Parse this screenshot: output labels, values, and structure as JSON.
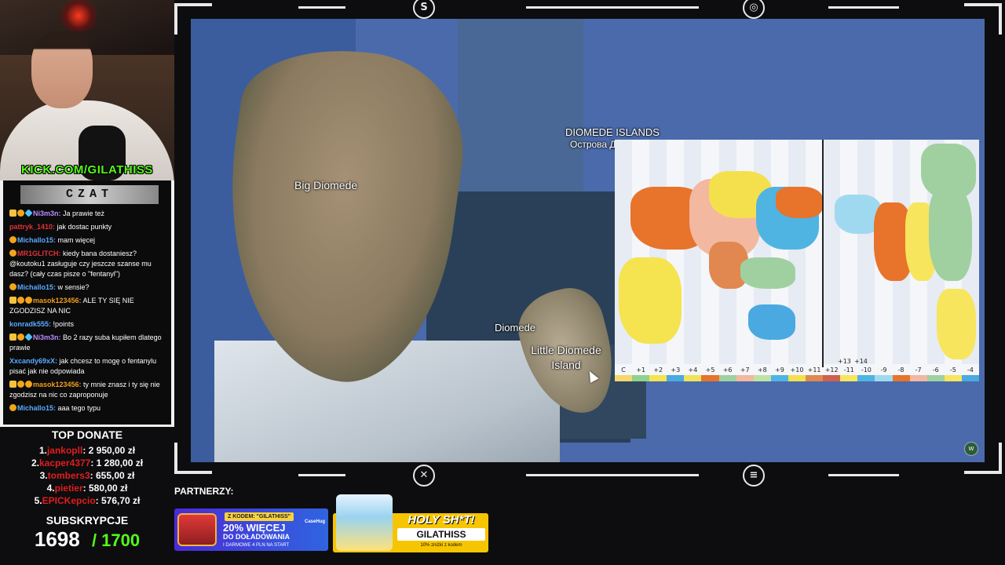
{
  "stream": {
    "kick_url": "KICK.COM/GILATHISS",
    "chat_title": "CZAT"
  },
  "chat": [
    {
      "badges": [
        "crown",
        "coin",
        "gem"
      ],
      "user": "Ni3m3n:",
      "user_color": "#b98cff",
      "text": "Ja prawie też"
    },
    {
      "badges": [],
      "user": "pattryk_1410:",
      "user_color": "#e0323a",
      "text": "jak dostac punkty"
    },
    {
      "badges": [
        "coin"
      ],
      "user": "Michallo15:",
      "user_color": "#5aa9ff",
      "text": "mam więcej"
    },
    {
      "badges": [
        "coin"
      ],
      "user": "MR1GLITCH:",
      "user_color": "#e0323a",
      "text": "kiedy bana dostaniesz? @koutoku1 zasługuje czy jeszcze szanse mu dasz? (cały czas pisze o \"fentanyl\")"
    },
    {
      "badges": [
        "coin"
      ],
      "user": "Michallo15:",
      "user_color": "#5aa9ff",
      "text": "w sensie?"
    },
    {
      "badges": [
        "crown",
        "coin",
        "coin"
      ],
      "user": "masok123456:",
      "user_color": "#f29b1f",
      "text": "ALE TY SIĘ NIE ZGODZISZ NA NIC"
    },
    {
      "badges": [],
      "user": "konradk555:",
      "user_color": "#5aa9ff",
      "text": "!points"
    },
    {
      "badges": [
        "crown",
        "coin",
        "gem"
      ],
      "user": "Ni3m3n:",
      "user_color": "#b98cff",
      "text": "Bo 2 razy suba kupiłem dlatego prawie"
    },
    {
      "badges": [],
      "user": "Xxcandy69xX:",
      "user_color": "#5aa9ff",
      "text": "jak chcesz to mogę o fentanylu pisać jak nie odpowiada"
    },
    {
      "badges": [
        "crown",
        "coin",
        "coin"
      ],
      "user": "masok123456:",
      "user_color": "#f29b1f",
      "text": "ty mnie znasz i ty się nie zgodzisz na nic co zaproponuje"
    },
    {
      "badges": [
        "coin"
      ],
      "user": "Michallo15:",
      "user_color": "#5aa9ff",
      "text": "aaa tego typu"
    }
  ],
  "donate": {
    "title": "TOP DONATE",
    "rows": [
      {
        "rank": "1.",
        "name": "jankopll",
        "amount": ": 2 950,00 zł"
      },
      {
        "rank": "2.",
        "name": "kacper4377",
        "amount": ": 1 280,00 zł"
      },
      {
        "rank": "3.",
        "name": "tombers3",
        "amount": ": 655,00 zł"
      },
      {
        "rank": "4.",
        "name": "pietier",
        "amount": ": 580,00 zł"
      },
      {
        "rank": "5.",
        "name": "EPICKepcio",
        "amount": ": 576,70 zł"
      }
    ]
  },
  "subs": {
    "title": "SUBSKRYPCJE",
    "current": "1698",
    "goal": "/ 1700"
  },
  "map": {
    "region_title": "DIOMEDE ISLANDS",
    "region_subtitle": "Острова Д",
    "big_island": "Big Diomede",
    "diomede": "Diomede",
    "little_island_line1": "Little Diomede",
    "little_island_line2": "Island"
  },
  "timezone_map": {
    "ticks": [
      "C",
      "+1",
      "+2",
      "+3",
      "+4",
      "+5",
      "+6",
      "+7",
      "+8",
      "+9",
      "+10",
      "+11",
      "+12",
      "-11",
      "-10",
      "-9",
      "-8",
      "-7",
      "-6",
      "-5",
      "-4"
    ],
    "extra_ticks": [
      "+13",
      "+14"
    ],
    "tick_colors": [
      "#f5d76e",
      "#8fd28f",
      "#f5e34f",
      "#4aa9e0",
      "#f0e35a",
      "#e8732a",
      "#a0d0a0",
      "#f2b8a0",
      "#bfe3a6",
      "#4fb4e2",
      "#f4e04d",
      "#e08850",
      "#d06050",
      "#f7e55e",
      "#4fb4e2",
      "#9fd9f0",
      "#e8732a",
      "#f2b8a0",
      "#a0d0a0",
      "#f7e55e",
      "#4aa9e0"
    ]
  },
  "partners": {
    "label": "PARTNERZY:",
    "casehug": {
      "code_tag": "Z KODEM: \"GILATHISS\"",
      "brand": "CaseHug",
      "big": "20% WIĘCEJ",
      "mid": "DO DOŁADOWANIA",
      "small": "I DARMOWE 4 PLN NA START"
    },
    "holy": {
      "title": "HOLY SH*T!",
      "code": "GILATHISS",
      "sub": "10% zniżki z kodem"
    }
  }
}
